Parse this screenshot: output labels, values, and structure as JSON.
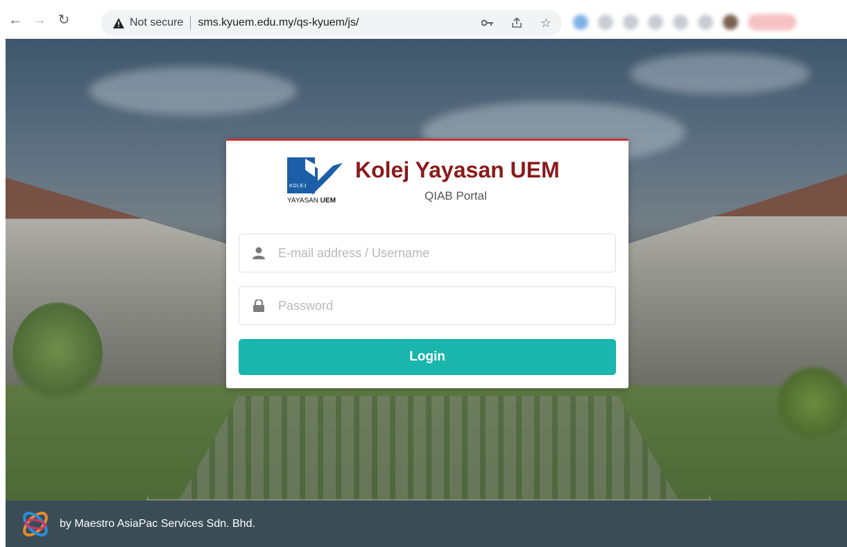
{
  "browser": {
    "security_label": "Not secure",
    "url": "sms.kyuem.edu.my/qs-kyuem/js/",
    "icons": [
      "back-arrow-icon",
      "forward-arrow-icon",
      "reload-icon",
      "warning-icon",
      "key-icon",
      "share-icon",
      "star-icon"
    ]
  },
  "brand": {
    "logo_small": "KOLEJ",
    "logo_text_regular": "YAYASAN",
    "logo_text_bold": "UEM",
    "title": "Kolej Yayasan UEM",
    "subtitle": "QIAB Portal",
    "title_color": "#8b1a1a"
  },
  "form": {
    "username_placeholder": "E-mail address / Username",
    "password_placeholder": "Password",
    "login_label": "Login",
    "button_color": "#1ab5ac"
  },
  "footer": {
    "credit": "by Maestro AsiaPac Services Sdn. Bhd."
  }
}
